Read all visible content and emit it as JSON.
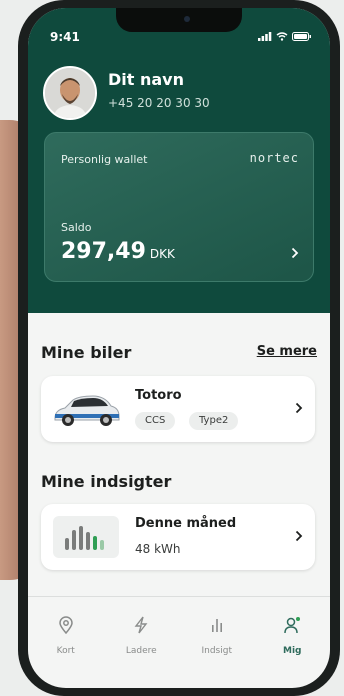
{
  "status_bar": {
    "time": "9:41"
  },
  "profile": {
    "name": "Dit navn",
    "phone": "+45 20 20 30 30"
  },
  "wallet": {
    "label": "Personlig wallet",
    "brand": "nortec",
    "balance_label": "Saldo",
    "amount": "297,49",
    "currency": "DKK"
  },
  "cars": {
    "title": "Mine biler",
    "see_more": "Se mere",
    "items": [
      {
        "name": "Totoro",
        "connectors": [
          "CCS",
          "Type2"
        ]
      }
    ]
  },
  "insights": {
    "title": "Mine indsigter",
    "items": [
      {
        "title": "Denne måned",
        "value": "48 kWh"
      }
    ]
  },
  "nav": [
    {
      "label": "Kort",
      "icon": "map-pin-icon"
    },
    {
      "label": "Ladere",
      "icon": "lightning-icon"
    },
    {
      "label": "Indsigt",
      "icon": "bar-chart-icon"
    },
    {
      "label": "Mig",
      "icon": "user-icon",
      "active": true
    }
  ],
  "colors": {
    "primary": "#0f4a3d",
    "accent": "#2f6b5c"
  }
}
